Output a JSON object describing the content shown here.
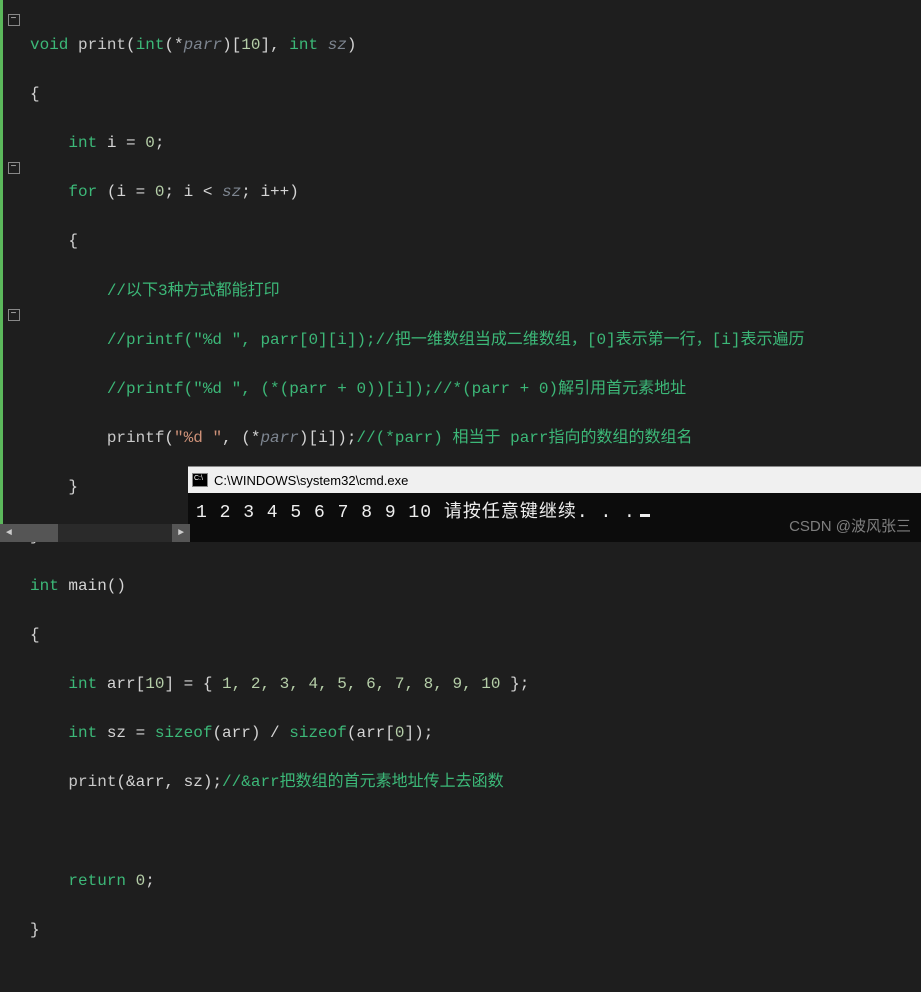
{
  "code": {
    "l1": {
      "kw": "void",
      "fn": "print",
      "params_open": "(",
      "type1": "int",
      "ptr": "(*",
      "param1": "parr",
      "arr": ")[",
      "ten": "10",
      "close1": "], ",
      "type2": "int",
      "sp": " ",
      "param2": "sz",
      "close2": ")"
    },
    "l2": "{",
    "l3": {
      "type": "int",
      "rest": " i = ",
      "zero": "0",
      "semi": ";"
    },
    "l4": {
      "kw": "for",
      "open": " (i = ",
      "z": "0",
      "mid": "; i < ",
      "sz": "sz",
      "mid2": "; i++)"
    },
    "l5": "    {",
    "l6": "        //以下3种方式都能打印",
    "l7": {
      "pre": "        //printf(\"%d \", parr[0][i]);",
      "cm": "//把一维数组当成二维数组，[0]表示第一行，[i]表示遍历"
    },
    "l8": {
      "pre": "        //printf(\"%d \", (*(parr + 0))[i]);",
      "cm": "//*(parr + 0)解引用首元素地址"
    },
    "l9": {
      "indent": "        ",
      "fn": "printf",
      "open": "(",
      "str": "\"%d \"",
      "comma": ", (*",
      "parr": "parr",
      "close": ")[i]);",
      "cm": "//(*parr) 相当于 parr指向的数组的数组名"
    },
    "l10": "    }",
    "l11": "}",
    "l12": {
      "type": "int",
      "fn": " main()"
    },
    "l13": "{",
    "l14": {
      "indent": "    ",
      "type": "int",
      "name": " arr[",
      "ten": "10",
      "close": "] = { ",
      "nums": "1, 2, 3, 4, 5, 6, 7, 8, 9, 10",
      "end": " };"
    },
    "l15": {
      "indent": "    ",
      "type": "int",
      "name": " sz = ",
      "sz1": "sizeof",
      "mid": "(arr) / ",
      "sz2": "sizeof",
      "end": "(arr[",
      "zero": "0",
      "end2": "]);"
    },
    "l16": {
      "indent": "    ",
      "fn": "print",
      "args": "(&arr, sz);",
      "cm": "//&arr把数组的首元素地址传上去函数"
    },
    "l17": "",
    "l18": {
      "indent": "    ",
      "kw": "return",
      "sp": " ",
      "zero": "0",
      "semi": ";"
    },
    "l19": "}"
  },
  "fold": {
    "minus": "−"
  },
  "console": {
    "title": "C:\\WINDOWS\\system32\\cmd.exe",
    "output": "1 2 3 4 5 6 7 8 9 10 请按任意键继续. . ."
  },
  "watermark": "CSDN @波风张三",
  "scroll": {
    "left": "◄",
    "right": "►"
  }
}
